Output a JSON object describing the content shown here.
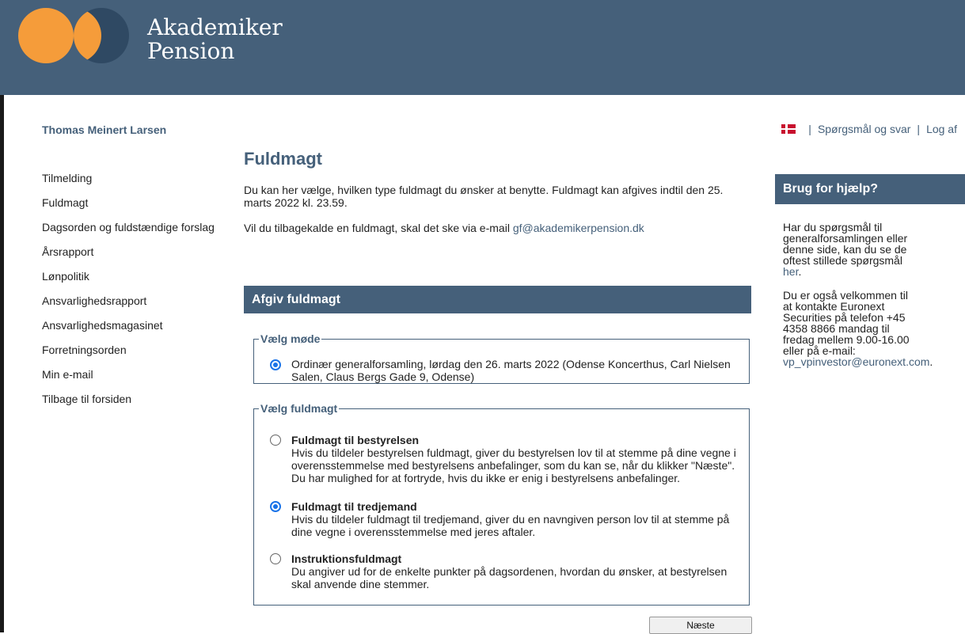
{
  "header": {
    "brand_line1": "Akademiker",
    "brand_line2": "Pension",
    "colors": {
      "header_bg": "#45607a",
      "logo_orange": "#f59c3a",
      "logo_blue": "#2f4963"
    }
  },
  "user": {
    "name": "Thomas Meinert Larsen"
  },
  "topbar": {
    "flag_icon": "danish-flag-icon",
    "sep1": "|",
    "faq_label": "Spørgsmål og svar",
    "sep2": "|",
    "logout_label": "Log af"
  },
  "nav": {
    "items": [
      "Tilmelding",
      "Fuldmagt",
      "Dagsorden og fuldstændige forslag",
      "Årsrapport",
      "Lønpolitik",
      "Ansvarlighedsrapport",
      "Ansvarlighedsmagasinet",
      "Forretningsorden",
      "Min e-mail",
      "Tilbage til forsiden"
    ]
  },
  "main": {
    "title": "Fuldmagt",
    "intro": "Du kan her vælge, hvilken type fuldmagt du ønsker at benytte. Fuldmagt kan afgives indtil den 25. marts 2022 kl. 23.59.",
    "revoke_text": "Vil du tilbagekalde en fuldmagt, skal det ske via e-mail ",
    "revoke_email": "gf@akademikerpension.dk",
    "section_title": "Afgiv fuldmagt",
    "meeting_legend": "Vælg møde",
    "meeting_option": "Ordinær generalforsamling, lørdag den 26. marts 2022 (Odense Koncerthus, Carl Nielsen Salen, Claus Bergs Gade 9, Odense)",
    "proxy_legend": "Vælg fuldmagt",
    "proxy_options": [
      {
        "title": "Fuldmagt til bestyrelsen",
        "desc": "Hvis du tildeler bestyrelsen fuldmagt, giver du bestyrelsen lov til at stemme på dine vegne i overensstemmelse med bestyrelsens anbefalinger, som du kan se, når du klikker \"Næste\". Du har mulighed for at fortryde, hvis du ikke er enig i bestyrelsens anbefalinger.",
        "selected": false
      },
      {
        "title": "Fuldmagt til tredjemand",
        "desc": "Hvis du tildeler fuldmagt til tredjemand, giver du en navngiven person lov til at stemme på dine vegne i overensstemmelse med jeres aftaler.",
        "selected": true
      },
      {
        "title": "Instruktionsfuldmagt",
        "desc": "Du angiver ud for de enkelte punkter på dagsordenen, hvordan du ønsker, at bestyrelsen skal anvende dine stemmer.",
        "selected": false
      }
    ],
    "next_label": "Næste"
  },
  "help": {
    "title": "Brug for hjælp?",
    "p1_text": "Har du spørgsmål til generalforsamlingen eller denne side, kan du se de oftest stillede spørgsmål ",
    "p1_link": "her",
    "p1_end": ".",
    "p2_text": "Du er også velkommen til at kontakte Euronext Securities på telefon +45 4358 8866 mandag til fredag mellem 9.00-16.00 eller på e-mail: ",
    "p2_email": "vp_vpinvestor@euronext.com",
    "p2_end": "."
  }
}
